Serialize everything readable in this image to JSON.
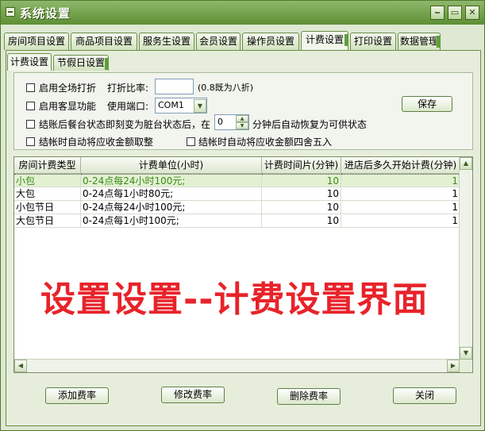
{
  "window": {
    "title": "系统设置",
    "controls": [
      "⎯",
      "▭",
      "✕"
    ]
  },
  "main_tabs": [
    {
      "label": "房间项目设置"
    },
    {
      "label": "商品项目设置"
    },
    {
      "label": "服务生设置"
    },
    {
      "label": "会员设置"
    },
    {
      "label": "操作员设置"
    },
    {
      "label": "计费设置",
      "active": true
    },
    {
      "label": "打印设置"
    },
    {
      "label": "数据管理"
    }
  ],
  "sub_tabs": [
    {
      "label": "计费设置",
      "active": true
    },
    {
      "label": "节假日设置"
    }
  ],
  "options": {
    "full_discount_label": "启用全场打折",
    "discount_rate_label": "打折比率:",
    "discount_rate_value": "",
    "discount_hint": "(0.8既为八折)",
    "customer_display_label": "启用客显功能",
    "port_label": "使用端口:",
    "port_value": "COM1",
    "dirty_label": "结账后餐台状态即刻变为脏台状态后，在",
    "dirty_minutes": "0",
    "dirty_suffix": "分钟后自动恢复为可供状态",
    "round_down_label": "结帐时自动将应收金额取整",
    "round_half_label": "结帐时自动将应收金额四舍五入",
    "save_label": "保存"
  },
  "table": {
    "headers": [
      "房间计费类型",
      "计费单位(小时)",
      "计费时间片(分钟)",
      "进店后多久开始计费(分钟)"
    ],
    "rows": [
      [
        "小包",
        "0-24点每24小时100元;",
        "10",
        "1"
      ],
      [
        "大包",
        "0-24点每1小时80元;",
        "10",
        "1"
      ],
      [
        "小包节日",
        "0-24点每24小时100元;",
        "10",
        "1"
      ],
      [
        "大包节日",
        "0-24点每1小时100元;",
        "10",
        "1"
      ]
    ]
  },
  "overlay_caption": "设置设置--计费设置界面",
  "buttons": {
    "add": "添加费率",
    "edit": "修改费率",
    "delete": "删除费率",
    "close": "关闭"
  }
}
